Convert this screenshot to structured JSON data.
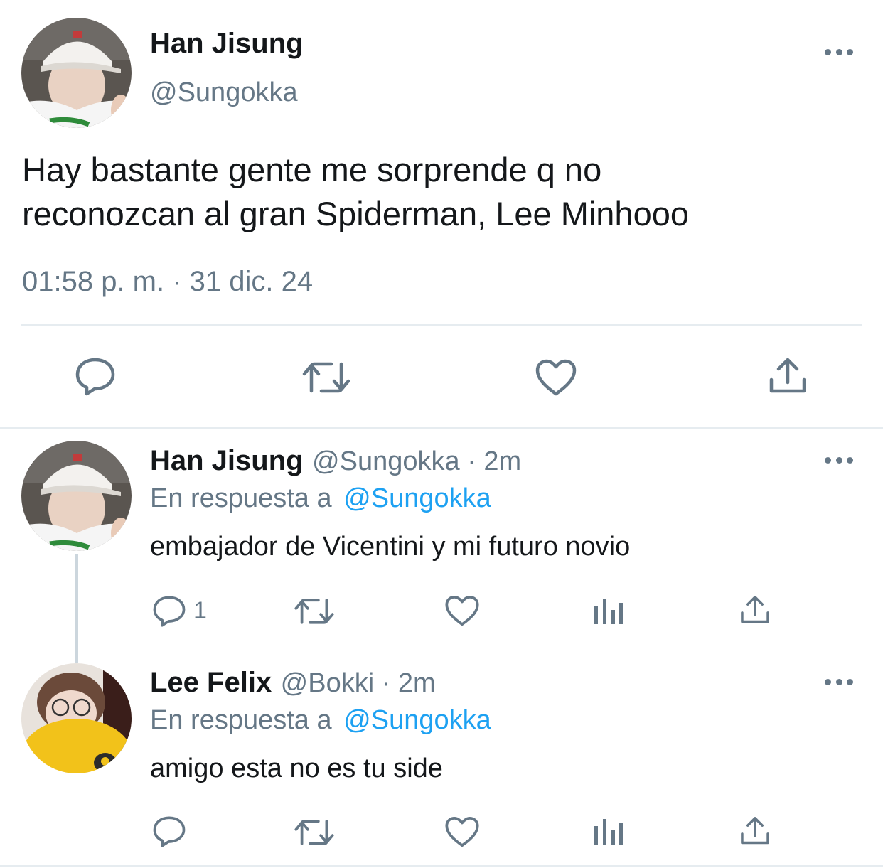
{
  "main_tweet": {
    "author_name": "Han Jisung",
    "author_handle": "@Sungokka",
    "text_line1": "Hay bastante gente me sorprende q no",
    "text_line2": "reconozcan al gran Spiderman, Lee Minhooo",
    "timestamp": "01:58 p. m. · 31 dic. 24",
    "actions": [
      "reply-icon",
      "retweet-icon",
      "like-icon",
      "share-icon"
    ]
  },
  "replies": [
    {
      "author_name": "Han Jisung",
      "author_handle": "@Sungokka · 2m",
      "reply_prefix": "En respuesta a",
      "reply_to": "@Sungokka",
      "text": "embajador de Vicentini y mi futuro novio",
      "reply_count": "1"
    },
    {
      "author_name": "Lee Felix",
      "author_handle": "@Bokki · 2m",
      "reply_prefix": "En respuesta a",
      "reply_to": "@Sungokka",
      "text": "amigo esta no es tu side",
      "reply_count": ""
    }
  ],
  "colors": {
    "text": "#14171a",
    "muted": "#657786",
    "link": "#1da1f2",
    "divider": "#e6ecf0"
  }
}
